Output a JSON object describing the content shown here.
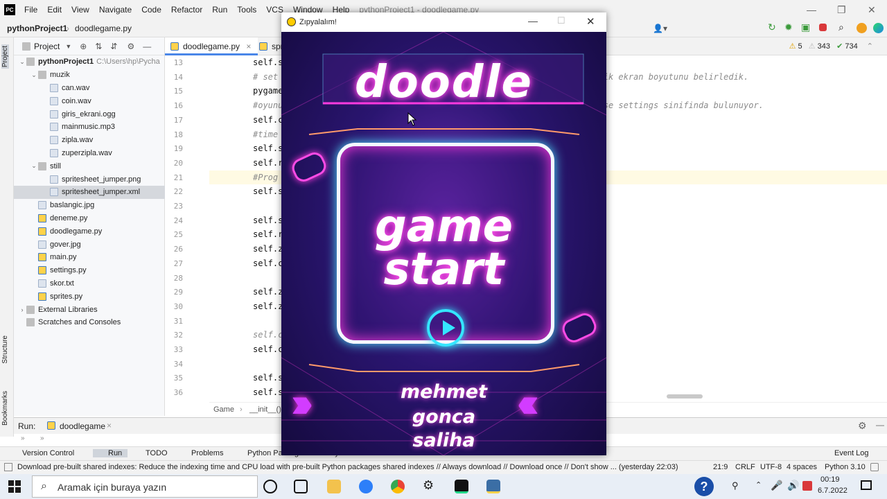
{
  "menubar": {
    "items": [
      "File",
      "Edit",
      "View",
      "Navigate",
      "Code",
      "Refactor",
      "Run",
      "Tools",
      "VCS",
      "Window",
      "Help"
    ],
    "title": "pythonProject1 - doodlegame.py"
  },
  "navbar": {
    "project": "pythonProject1",
    "file": "doodlegame.py",
    "run_config": "doodlegame"
  },
  "project_panel": {
    "label": "Project",
    "tree": [
      {
        "label": "pythonProject1",
        "hint": "C:\\Users\\hp\\Pycha",
        "type": "folder",
        "level": 0,
        "open": true
      },
      {
        "label": "muzik",
        "type": "folder",
        "level": 1,
        "open": true
      },
      {
        "label": "can.wav",
        "type": "file",
        "level": 2
      },
      {
        "label": "coin.wav",
        "type": "file",
        "level": 2
      },
      {
        "label": "giris_ekrani.ogg",
        "type": "file",
        "level": 2
      },
      {
        "label": "mainmusic.mp3",
        "type": "file",
        "level": 2
      },
      {
        "label": "zipla.wav",
        "type": "file",
        "level": 2
      },
      {
        "label": "zuperzipla.wav",
        "type": "file",
        "level": 2
      },
      {
        "label": "still",
        "type": "folder",
        "level": 1,
        "open": true
      },
      {
        "label": "spritesheet_jumper.png",
        "type": "file",
        "level": 2
      },
      {
        "label": "spritesheet_jumper.xml",
        "type": "file",
        "level": 2,
        "selected": true
      },
      {
        "label": "baslangic.jpg",
        "type": "file",
        "level": 1
      },
      {
        "label": "deneme.py",
        "type": "py",
        "level": 1
      },
      {
        "label": "doodlegame.py",
        "type": "py",
        "level": 1
      },
      {
        "label": "gover.jpg",
        "type": "file",
        "level": 1
      },
      {
        "label": "main.py",
        "type": "py",
        "level": 1
      },
      {
        "label": "settings.py",
        "type": "py",
        "level": 1
      },
      {
        "label": "skor.txt",
        "type": "file",
        "level": 1
      },
      {
        "label": "sprites.py",
        "type": "py",
        "level": 1
      },
      {
        "label": "External Libraries",
        "type": "folder",
        "level": 0,
        "open": false
      },
      {
        "label": "Scratches and Consoles",
        "type": "folder",
        "level": 0
      }
    ]
  },
  "left_strip": {
    "project": "Project",
    "structure": "Structure",
    "bookmarks": "Bookmarks"
  },
  "editor": {
    "tabs": [
      "doodlegame.py",
      "spr"
    ],
    "inspections": {
      "warnings": "5",
      "weak": "343",
      "ok": "734"
    },
    "lines": [
      {
        "n": "13",
        "text": "self.s",
        "kind": "code"
      },
      {
        "n": "14",
        "text": "# set                                                        arak verdik ekran boyutunu belirledik.",
        "kind": "comment"
      },
      {
        "n": "15",
        "text": "pygame",
        "kind": "code"
      },
      {
        "n": "16",
        "text": "#oyunu                                                       eiskeni ise settings sinifinda bulunuyor.",
        "kind": "comment"
      },
      {
        "n": "17",
        "text": "self.c",
        "kind": "code"
      },
      {
        "n": "18",
        "text": "#time",
        "kind": "comment"
      },
      {
        "n": "19",
        "text": "self.s",
        "kind": "code"
      },
      {
        "n": "20",
        "text": "self.r",
        "kind": "code"
      },
      {
        "n": "21",
        "text": "#Prog",
        "kind": "comment"
      },
      {
        "n": "22",
        "text": "self.s",
        "kind": "code"
      },
      {
        "n": "23",
        "text": "",
        "kind": "code"
      },
      {
        "n": "24",
        "text": "self.s",
        "kind": "code"
      },
      {
        "n": "25",
        "text": "self.r",
        "kind": "code"
      },
      {
        "n": "26",
        "text": "self.z",
        "kind": "code"
      },
      {
        "n": "27",
        "text": "self.c",
        "kind": "code"
      },
      {
        "n": "28",
        "text": "",
        "kind": "code"
      },
      {
        "n": "29",
        "text": "self.z",
        "kind": "code"
      },
      {
        "n": "30",
        "text": "self.z",
        "kind": "code"
      },
      {
        "n": "31",
        "text": "",
        "kind": "code"
      },
      {
        "n": "32",
        "text": "self.c                                                       nki ses",
        "kind": "comment"
      },
      {
        "n": "33",
        "text": "self.c",
        "kind": "code"
      },
      {
        "n": "34",
        "text": "",
        "kind": "code"
      },
      {
        "n": "35",
        "text": "self.s",
        "kind": "code"
      },
      {
        "n": "36",
        "text": "self.s",
        "kind": "code"
      }
    ],
    "breadcrumb": [
      "Game",
      "__init__()"
    ]
  },
  "run_panel": {
    "label": "Run:",
    "config": "doodlegame"
  },
  "tool_windows": [
    "Version Control",
    "Run",
    "TODO",
    "Problems",
    "Python Packages",
    "Python Console",
    "Terminal",
    "Event Log"
  ],
  "status": {
    "message": "Download pre-built shared indexes: Reduce the indexing time and CPU load with pre-built Python packages shared indexes // Always download // Download once // Don't show ... (yesterday 22:03)",
    "position": "21:9",
    "line_sep": "CRLF",
    "encoding": "UTF-8",
    "indent": "4 spaces",
    "interpreter": "Python 3.10"
  },
  "game_window": {
    "title": "Zıpyalalım!",
    "logo": "doodle",
    "line1": "game",
    "line2": "start",
    "names": [
      "mehmet",
      "gonca",
      "saliha"
    ]
  },
  "taskbar": {
    "search_placeholder": "Aramak için buraya yazın",
    "time": "00:19",
    "date": "6.7.2022"
  },
  "colors": {
    "accent": "#4a86e8",
    "neon_pink": "#ff3be0",
    "neon_cyan": "#34e6ff",
    "game_bg": "#1a0c4a"
  }
}
